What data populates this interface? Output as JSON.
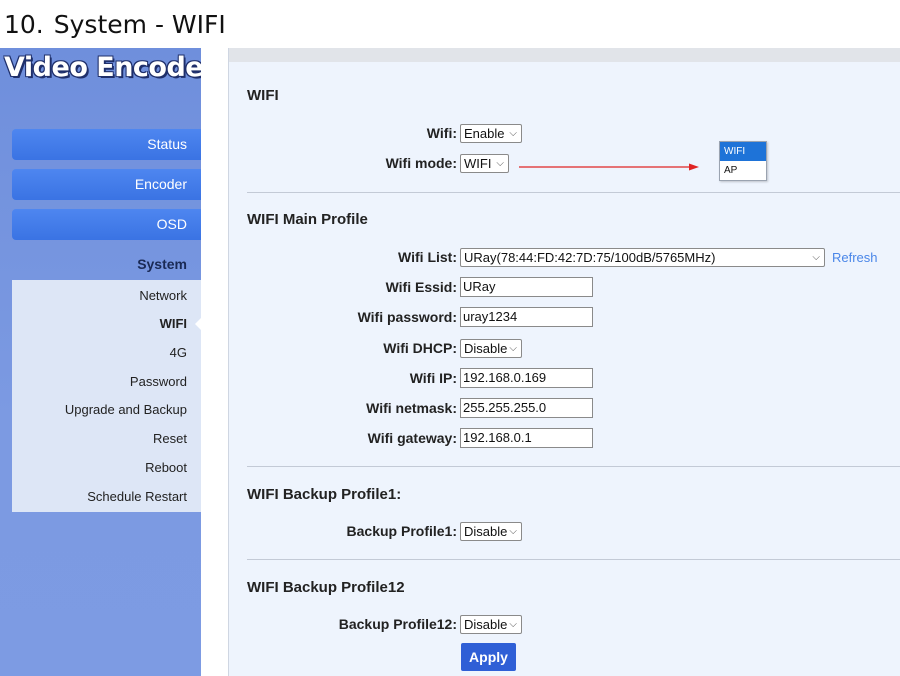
{
  "doc_heading": {
    "number": "10.",
    "title": "System - WIFI"
  },
  "sidebar": {
    "logo": "Video Encoder",
    "buttons": [
      "Status",
      "Encoder",
      "OSD"
    ],
    "section": "System",
    "sub_items": [
      "Network",
      "WIFI",
      "4G",
      "Password",
      "Upgrade and Backup",
      "Reset",
      "Reboot",
      "Schedule Restart"
    ],
    "active_sub_item": "WIFI"
  },
  "wifi_section": {
    "title": "WIFI",
    "wifi_label": "Wifi:",
    "wifi_value": "Enable",
    "mode_label": "Wifi mode:",
    "mode_value": "WIFI",
    "mode_options": [
      "WIFI",
      "AP"
    ],
    "mode_options_selected": "WIFI"
  },
  "main_profile": {
    "title": "WIFI Main Profile",
    "list_label": "Wifi List:",
    "list_value": "URay(78:44:FD:42:7D:75/100dB/5765MHz)",
    "refresh_label": "Refresh",
    "essid_label": "Wifi Essid:",
    "essid_value": "URay",
    "password_label": "Wifi password:",
    "password_value": "uray1234",
    "dhcp_label": "Wifi DHCP:",
    "dhcp_value": "Disable",
    "ip_label": "Wifi IP:",
    "ip_value": "192.168.0.169",
    "netmask_label": "Wifi netmask:",
    "netmask_value": "255.255.255.0",
    "gateway_label": "Wifi gateway:",
    "gateway_value": "192.168.0.1"
  },
  "backup1": {
    "title": "WIFI Backup Profile1:",
    "label": "Backup Profile1:",
    "value": "Disable"
  },
  "backup12": {
    "title": "WIFI Backup Profile12",
    "label": "Backup Profile12:",
    "value": "Disable"
  },
  "apply_label": "Apply",
  "colors": {
    "sidebar": "#7c9ae2",
    "nav_button": "#3f7ae8",
    "content_bg": "#eef4fd",
    "link": "#4a86e8",
    "annotation_arrow": "#e02424",
    "apply_button": "#2f5fd6"
  }
}
